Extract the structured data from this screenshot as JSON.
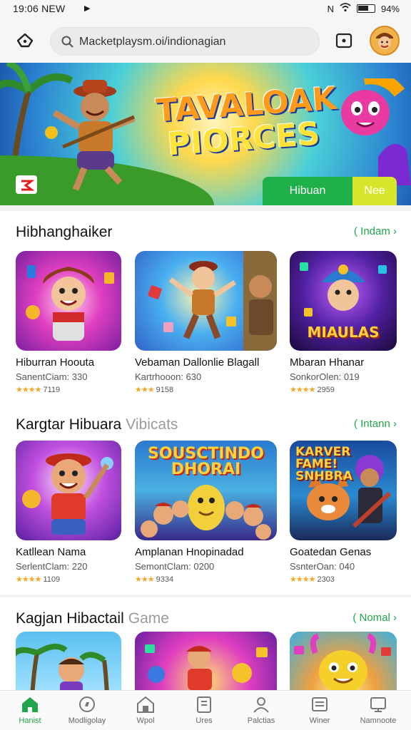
{
  "status_bar": {
    "time": "19:06 NEW",
    "battery": "94%"
  },
  "header": {
    "search_text": "Macketplaysm.oi/indionagian"
  },
  "banner": {
    "title_line1": "TAVALOAK",
    "title_line2": "PIORCES",
    "button_primary": "Hibuan",
    "button_secondary": "Nee"
  },
  "sections": [
    {
      "title": "Hibhanghaiker",
      "title_extra": "",
      "more": "( Indam ›",
      "apps": [
        {
          "name": "Hiburran Hoouta",
          "developer": "SanentCiam: 330",
          "stars": "★★★★",
          "rating": "7119",
          "art_text": ""
        },
        {
          "name": "Vebaman Dallonlie Blagall",
          "developer": "Kartrhooon: 630",
          "stars": "★★★",
          "rating": "9158",
          "art_text": ""
        },
        {
          "name": "Mbaran Hhanar",
          "developer": "SonkorOlen: 019",
          "stars": "★★★★",
          "rating": "2959",
          "art_text": "MIAULAS"
        }
      ]
    },
    {
      "title": "Kargtar Hibuara",
      "title_extra": "Vibicats",
      "more": "( Intann ›",
      "apps": [
        {
          "name": "Katllean Nama",
          "developer": "SerlentClam: 220",
          "stars": "★★★★",
          "rating": "1109",
          "art_text": ""
        },
        {
          "name": "Amplanan Hnopinadad",
          "developer": "SemontClam: 0200",
          "stars": "★★★",
          "rating": "9334",
          "art_text": "SOUSCTINDO DHORAI"
        },
        {
          "name": "Goatedan Genas",
          "developer": "SsnterOan: 040",
          "stars": "★★★★",
          "rating": "2303",
          "art_text": "KARVER FAME! SNHBRA"
        }
      ]
    },
    {
      "title": "Kagjan Hibactail",
      "title_extra": "Game",
      "more": "( Nomal ›",
      "apps": []
    }
  ],
  "bottom_nav": [
    {
      "label": "Hanist",
      "icon": "home-icon",
      "active": true
    },
    {
      "label": "Modligolay",
      "icon": "compass-icon",
      "active": false
    },
    {
      "label": "Wpol",
      "icon": "house-icon",
      "active": false
    },
    {
      "label": "Ures",
      "icon": "book-icon",
      "active": false
    },
    {
      "label": "Palctias",
      "icon": "person-icon",
      "active": false
    },
    {
      "label": "Winer",
      "icon": "card-icon",
      "active": false
    },
    {
      "label": "Namnoote",
      "icon": "monitor-icon",
      "active": false
    }
  ],
  "colors": {
    "accent": "#1fa54a",
    "banner_button_b": "#d6e62a",
    "star": "#f5a623"
  }
}
